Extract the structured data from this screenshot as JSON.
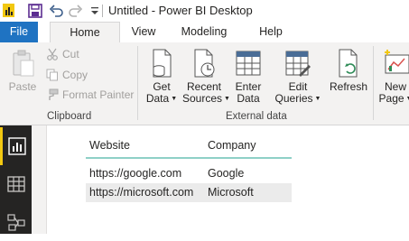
{
  "window": {
    "title": "Untitled - Power BI Desktop"
  },
  "tabs": [
    {
      "label": "File"
    },
    {
      "label": "Home"
    },
    {
      "label": "View"
    },
    {
      "label": "Modeling"
    },
    {
      "label": "Help"
    }
  ],
  "ribbon": {
    "clipboard": {
      "paste": "Paste",
      "cut": "Cut",
      "copy": "Copy",
      "format_painter": "Format Painter",
      "group_label": "Clipboard"
    },
    "external_data": {
      "get_data": [
        "Get",
        "Data"
      ],
      "recent_sources": [
        "Recent",
        "Sources"
      ],
      "enter_data": [
        "Enter",
        "Data"
      ],
      "edit_queries": [
        "Edit",
        "Queries"
      ],
      "refresh": "Refresh",
      "group_label": "External data"
    },
    "new_page": [
      "New",
      "Page"
    ]
  },
  "table": {
    "columns": [
      "Website",
      "Company"
    ],
    "rows": [
      [
        "https://google.com",
        "Google"
      ],
      [
        "https://microsoft.com",
        "Microsoft"
      ]
    ]
  },
  "colors": {
    "accent_blue": "#1f73c2",
    "nav_active": "#f2c811",
    "table_header_underline": "#8fd0c7"
  }
}
